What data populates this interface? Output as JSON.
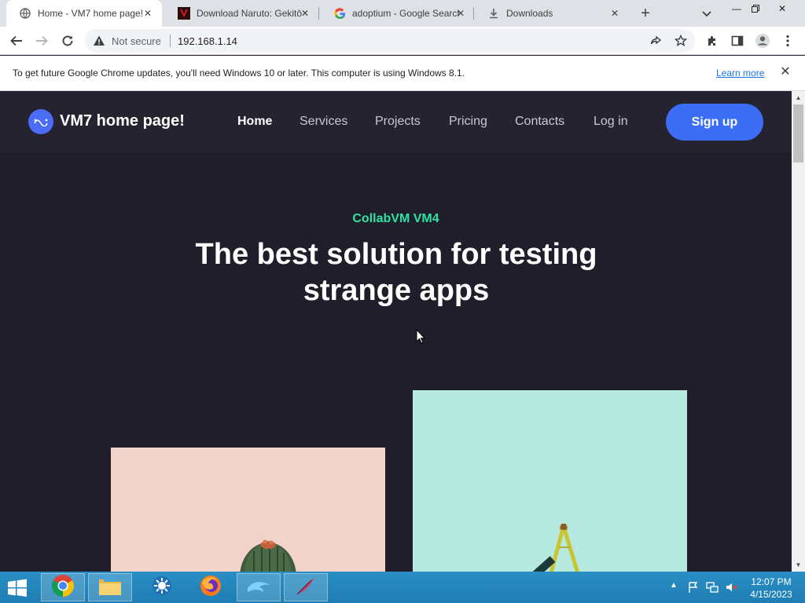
{
  "browser": {
    "tabs": [
      {
        "title": "Home - VM7 home page!",
        "icon": "globe-icon",
        "active": true
      },
      {
        "title": "Download Naruto: Gekitō",
        "icon": "naruto-favicon-icon",
        "active": false
      },
      {
        "title": "adoptium - Google Search",
        "icon": "google-icon",
        "active": false
      },
      {
        "title": "Downloads",
        "icon": "download-icon",
        "active": false
      }
    ],
    "new_tab_label": "+",
    "address": {
      "security_text": "Not secure",
      "url": "192.168.1.14"
    }
  },
  "infobar": {
    "message": "To get future Google Chrome updates, you'll need Windows 10 or later. This computer is using Windows 8.1.",
    "link": "Learn more"
  },
  "site": {
    "brand": "VM7 home page!",
    "nav": [
      "Home",
      "Services",
      "Projects",
      "Pricing",
      "Contacts",
      "Log in"
    ],
    "cta": "Sign up",
    "eyebrow": "CollabVM VM4",
    "headline": "The best solution for testing strange apps",
    "colors": {
      "accent": "#3b6ef5",
      "eyebrow": "#2ee3a3",
      "background": "#1f1e2a"
    }
  },
  "taskbar": {
    "time": "12:07 PM",
    "date": "4/15/2023",
    "apps": [
      "chrome-icon",
      "file-explorer-icon",
      "weather-sun-icon",
      "firefox-icon",
      "dolphin-icon",
      "feather-icon"
    ]
  }
}
